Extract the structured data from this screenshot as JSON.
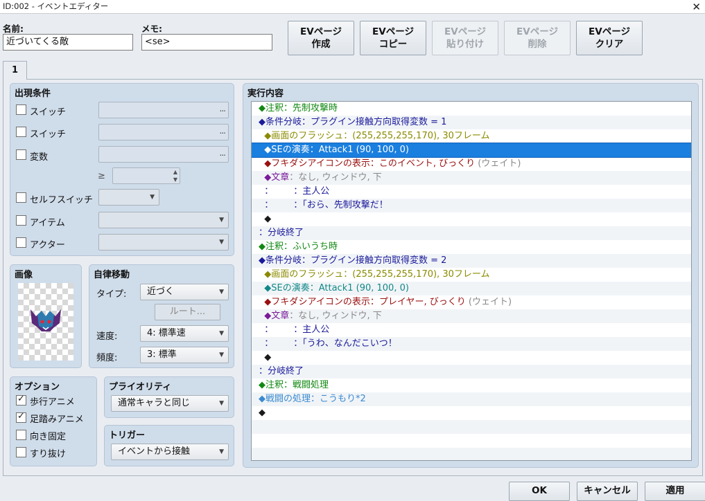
{
  "window": {
    "title": "ID:002 - イベントエディター",
    "close": "✕"
  },
  "name_label": "名前:",
  "name_value": "近づいてくる敵",
  "memo_label": "メモ:",
  "memo_value": "<se>",
  "ev_buttons": [
    {
      "l1": "EVページ",
      "l2": "作成",
      "enabled": true
    },
    {
      "l1": "EVページ",
      "l2": "コピー",
      "enabled": true
    },
    {
      "l1": "EVページ",
      "l2": "貼り付け",
      "enabled": false
    },
    {
      "l1": "EVページ",
      "l2": "削除",
      "enabled": false
    },
    {
      "l1": "EVページ",
      "l2": "クリア",
      "enabled": true
    }
  ],
  "tab": "1",
  "conditions": {
    "title": "出現条件",
    "switch1": "スイッチ",
    "switch2": "スイッチ",
    "variable": "変数",
    "ge": "≥",
    "self_switch": "セルフスイッチ",
    "item": "アイテム",
    "actor": "アクター",
    "dots": "..."
  },
  "image": {
    "title": "画像"
  },
  "autonomous": {
    "title": "自律移動",
    "type_label": "タイプ:",
    "type_value": "近づく",
    "route": "ルート...",
    "speed_label": "速度:",
    "speed_value": "4: 標準速",
    "freq_label": "頻度:",
    "freq_value": "3: 標準"
  },
  "options": {
    "title": "オプション",
    "walk": "歩行アニメ",
    "step": "足踏みアニメ",
    "dirfix": "向き固定",
    "through": "すり抜け"
  },
  "priority": {
    "title": "プライオリティ",
    "value": "通常キャラと同じ"
  },
  "trigger": {
    "title": "トリガー",
    "value": "イベントから接触"
  },
  "content": {
    "title": "実行内容"
  },
  "commands": [
    {
      "text": "◆注釈：先制攻撃時",
      "color": "#118811"
    },
    {
      "text": "◆条件分岐：プラグイン接触方向取得変数 = 1",
      "color": "#1a1a9a"
    },
    {
      "text": "  ◆画面のフラッシュ：(255,255,255,170), 30フレーム",
      "color": "#8a8a00"
    },
    {
      "text": "  ◆SEの演奏：Attack1 (90, 100, 0)",
      "color": "#118888",
      "selected": true
    },
    {
      "text": "  ◆フキダシアイコンの表示：このイベント, びっくり",
      "color": "#9a1010",
      "suffix": " (ウェイト)",
      "suffix_color": "#888888"
    },
    {
      "text": "  ◆文章",
      "color": "#7a1a9a",
      "suffix": "：なし, ウィンドウ, 下",
      "suffix_color": "#888888"
    },
    {
      "text": "  ：       ：主人公",
      "color": "#1a1a9a"
    },
    {
      "text": "  ：       ：「おら、先制攻撃だ！",
      "color": "#1a1a9a"
    },
    {
      "text": "  ◆",
      "color": "#1a1a1a"
    },
    {
      "text": "：分岐終了",
      "color": "#1a1a9a"
    },
    {
      "text": "◆注釈：ふいうち時",
      "color": "#118811"
    },
    {
      "text": "◆条件分岐：プラグイン接触方向取得変数 = 2",
      "color": "#1a1a9a"
    },
    {
      "text": "  ◆画面のフラッシュ：(255,255,255,170), 30フレーム",
      "color": "#8a8a00"
    },
    {
      "text": "  ◆SEの演奏：Attack1 (90, 100, 0)",
      "color": "#118888"
    },
    {
      "text": "  ◆フキダシアイコンの表示：プレイヤー, びっくり",
      "color": "#9a1010",
      "suffix": " (ウェイト)",
      "suffix_color": "#888888"
    },
    {
      "text": "  ◆文章",
      "color": "#7a1a9a",
      "suffix": "：なし, ウィンドウ, 下",
      "suffix_color": "#888888"
    },
    {
      "text": "  ：       ：主人公",
      "color": "#1a1a9a"
    },
    {
      "text": "  ：       ：「うわ、なんだこいつ！",
      "color": "#1a1a9a"
    },
    {
      "text": "  ◆",
      "color": "#1a1a1a"
    },
    {
      "text": "：分岐終了",
      "color": "#1a1a9a"
    },
    {
      "text": "◆注釈：戦闘処理",
      "color": "#118811"
    },
    {
      "text": "◆戦闘の処理：こうもり*2",
      "color": "#3a8ad0"
    },
    {
      "text": "◆",
      "color": "#1a1a1a"
    }
  ],
  "buttons": {
    "ok": "OK",
    "cancel": "キャンセル",
    "apply": "適用"
  }
}
